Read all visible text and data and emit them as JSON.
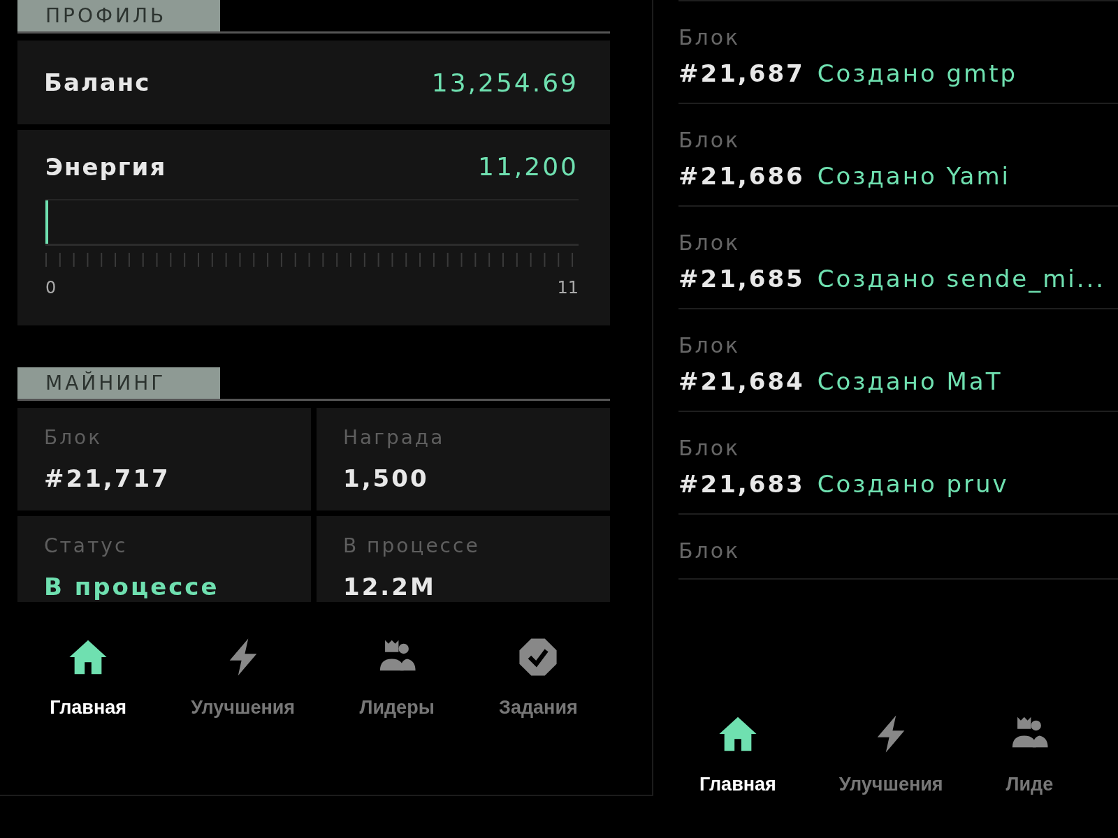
{
  "profile": {
    "title": "ПРОФИЛЬ",
    "balance": {
      "label": "Баланс",
      "value": "13,254.69"
    },
    "energy": {
      "label": "Энергия",
      "value": "11,200",
      "level": 0.004,
      "min": "0",
      "max": "11"
    }
  },
  "mining": {
    "title": "МАЙНИНГ",
    "cells": [
      {
        "label": "Блок",
        "value": "#21,717",
        "highlight": false
      },
      {
        "label": "Награда",
        "value": "1,500",
        "highlight": false
      },
      {
        "label": "Статус",
        "value": "В процессе",
        "highlight": true
      },
      {
        "label": "В процессе",
        "value": "12.2M",
        "highlight": false
      }
    ]
  },
  "nav": [
    {
      "label": "Главная",
      "selected": true
    },
    {
      "label": "Улучшения",
      "selected": false
    },
    {
      "label": "Лидеры",
      "selected": false
    },
    {
      "label": "Задания",
      "selected": false
    }
  ],
  "blocks": [
    {
      "label": "Блок",
      "number": "#21,687",
      "text": "Создано gmtp"
    },
    {
      "label": "Блок",
      "number": "#21,686",
      "text": "Создано Yami"
    },
    {
      "label": "Блок",
      "number": "#21,685",
      "text": "Создано sende_mi..."
    },
    {
      "label": "Блок",
      "number": "#21,684",
      "text": "Создано MaT"
    },
    {
      "label": "Блок",
      "number": "#21,683",
      "text": "Создано pruv"
    },
    {
      "label": "Блок"
    }
  ],
  "nav_right": [
    {
      "label": "Главная",
      "selected": true
    },
    {
      "label": "Улучшения",
      "selected": false
    },
    {
      "label": "Лиде",
      "selected": false
    }
  ]
}
